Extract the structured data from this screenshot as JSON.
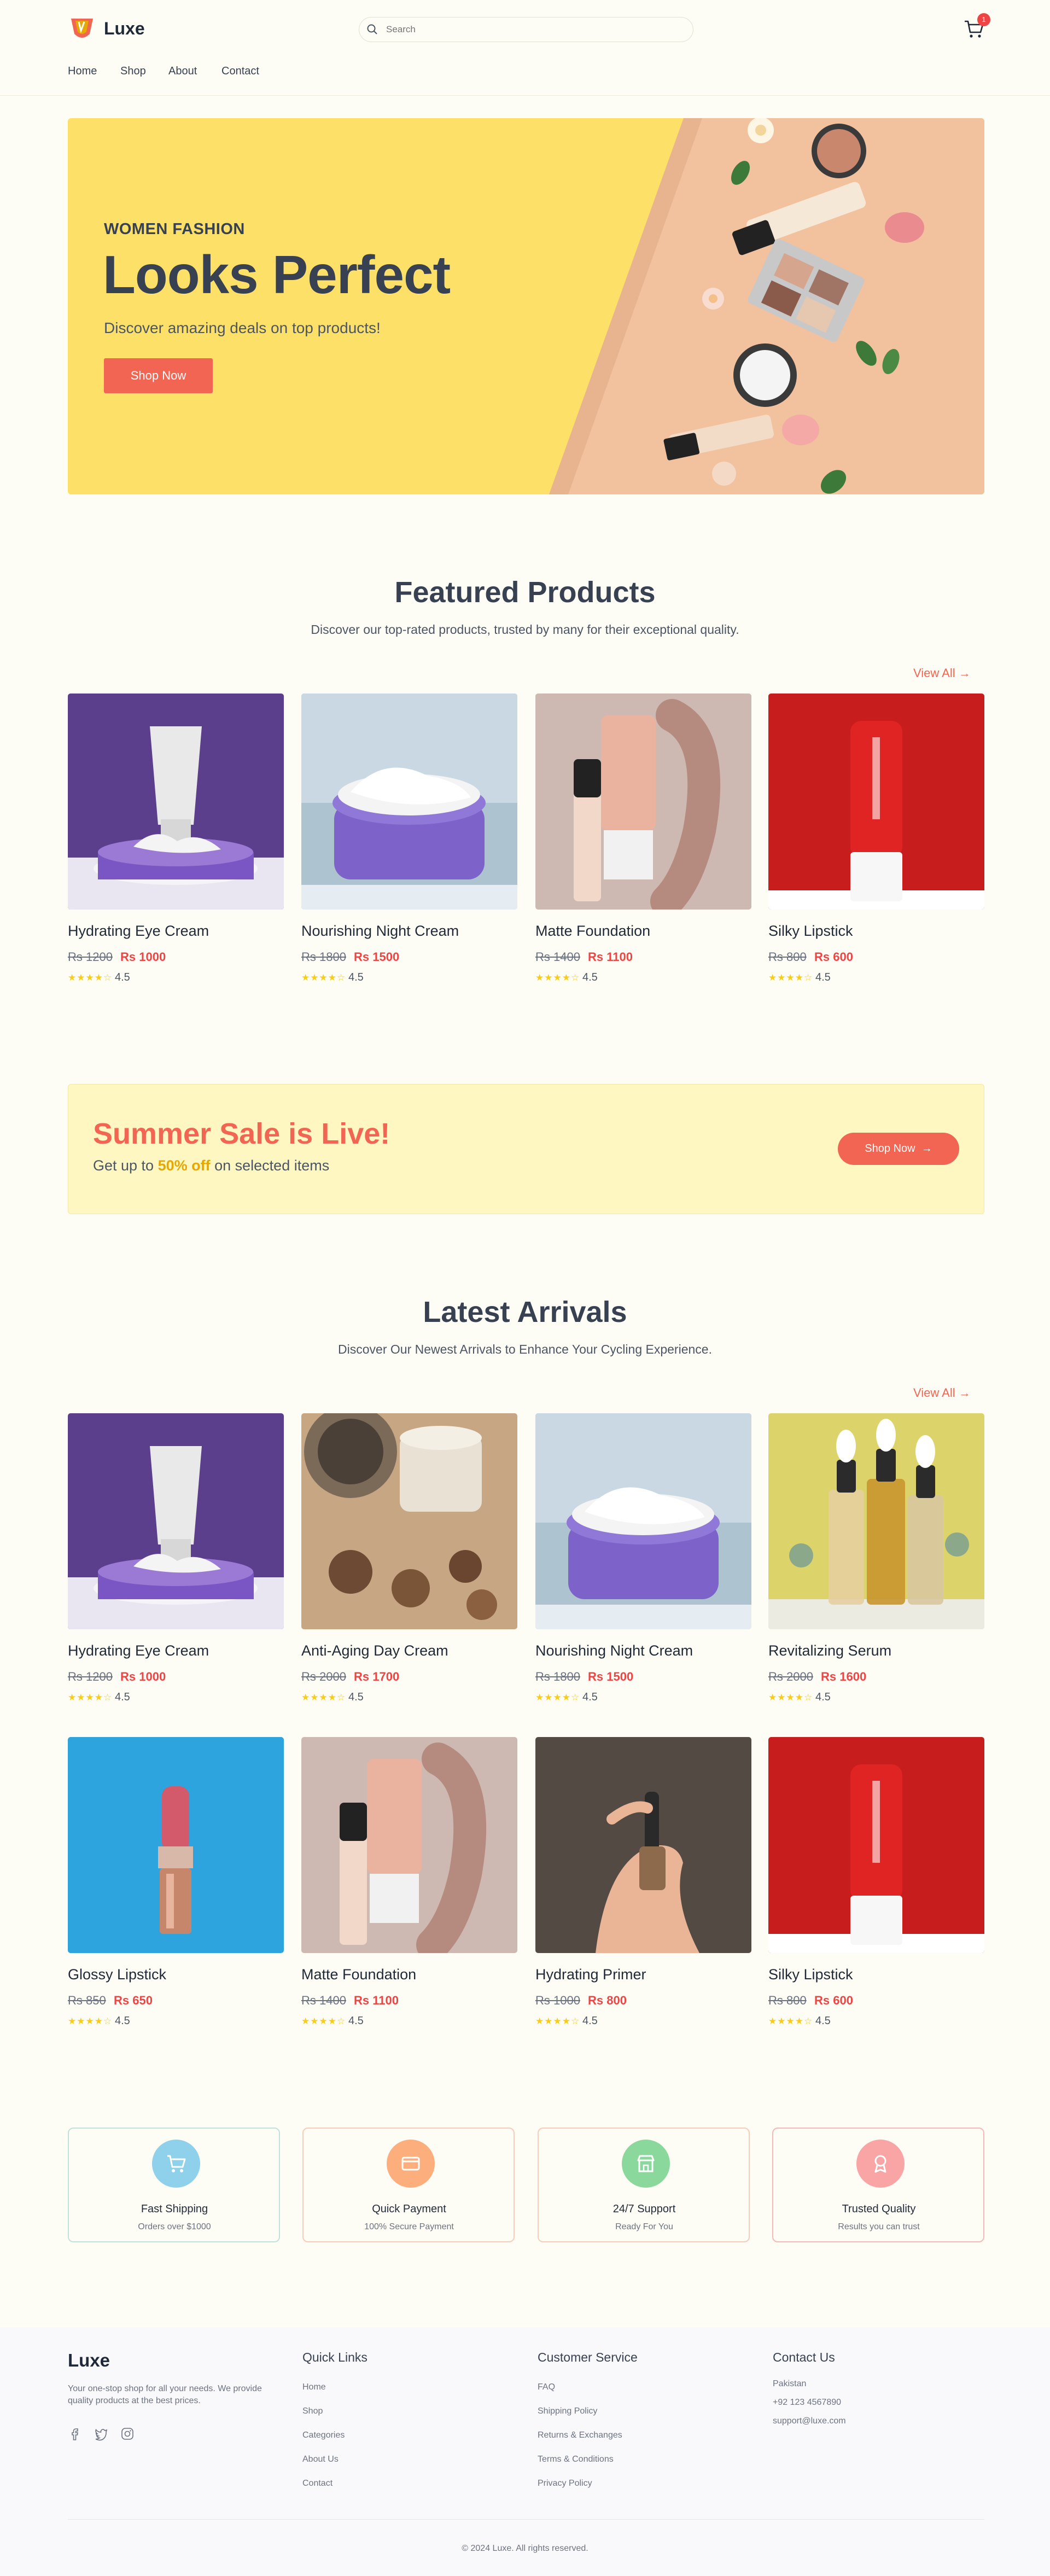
{
  "header": {
    "brand": "Luxe",
    "search_placeholder": "Search",
    "cart_count": "1",
    "nav": [
      "Home",
      "Shop",
      "About",
      "Contact"
    ]
  },
  "hero": {
    "eyebrow": "WOMEN FASHION",
    "title": "Looks Perfect",
    "subtitle": "Discover amazing deals on top products!",
    "button": "Shop Now"
  },
  "featured": {
    "title": "Featured Products",
    "subtitle": "Discover our top-rated products, trusted by many for their exceptional quality.",
    "view_all": "View All",
    "products": [
      {
        "name": "Hydrating Eye Cream",
        "old_price": "Rs 1200",
        "price": "Rs 1000",
        "stars": "★★★★☆",
        "rating": "4.5",
        "image": "eye-cream-tube"
      },
      {
        "name": "Nourishing Night Cream",
        "old_price": "Rs 1800",
        "price": "Rs 1500",
        "stars": "★★★★☆",
        "rating": "4.5",
        "image": "night-cream-jar"
      },
      {
        "name": "Matte Foundation",
        "old_price": "Rs 1400",
        "price": "Rs 1100",
        "stars": "★★★★☆",
        "rating": "4.5",
        "image": "foundation-tubes"
      },
      {
        "name": "Silky Lipstick",
        "old_price": "Rs 800",
        "price": "Rs 600",
        "stars": "★★★★☆",
        "rating": "4.5",
        "image": "red-lipstick"
      }
    ]
  },
  "sale": {
    "title": "Summer Sale is Live!",
    "subtitle_prefix": "Get up to ",
    "highlight": "50% off",
    "subtitle_suffix": " on selected items",
    "button": "Shop Now"
  },
  "latest": {
    "title": "Latest Arrivals",
    "subtitle": "Discover Our Newest Arrivals to Enhance Your Cycling Experience.",
    "view_all": "View All",
    "products": [
      {
        "name": "Hydrating Eye Cream",
        "old_price": "Rs 1200",
        "price": "Rs 1000",
        "stars": "★★★★☆",
        "rating": "4.5",
        "image": "eye-cream-tube"
      },
      {
        "name": "Anti-Aging Day Cream",
        "old_price": "Rs 2000",
        "price": "Rs 1700",
        "stars": "★★★★☆",
        "rating": "4.5",
        "image": "day-cream-jar"
      },
      {
        "name": "Nourishing Night Cream",
        "old_price": "Rs 1800",
        "price": "Rs 1500",
        "stars": "★★★★☆",
        "rating": "4.5",
        "image": "night-cream-jar"
      },
      {
        "name": "Revitalizing Serum",
        "old_price": "Rs 2000",
        "price": "Rs 1600",
        "stars": "★★★★☆",
        "rating": "4.5",
        "image": "serum-bottles"
      },
      {
        "name": "Glossy Lipstick",
        "old_price": "Rs 850",
        "price": "Rs 650",
        "stars": "★★★★☆",
        "rating": "4.5",
        "image": "pink-lipstick"
      },
      {
        "name": "Matte Foundation",
        "old_price": "Rs 1400",
        "price": "Rs 1100",
        "stars": "★★★★☆",
        "rating": "4.5",
        "image": "foundation-tubes"
      },
      {
        "name": "Hydrating Primer",
        "old_price": "Rs 1000",
        "price": "Rs 800",
        "stars": "★★★★☆",
        "rating": "4.5",
        "image": "primer-dropper"
      },
      {
        "name": "Silky Lipstick",
        "old_price": "Rs 800",
        "price": "Rs 600",
        "stars": "★★★★☆",
        "rating": "4.5",
        "image": "red-lipstick"
      }
    ]
  },
  "features": [
    {
      "title": "Fast Shipping",
      "subtitle": "Orders over $1000",
      "icon": "cart-icon",
      "color": "#8fd0ea",
      "border": "#bfe3dc"
    },
    {
      "title": "Quick Payment",
      "subtitle": "100% Secure Payment",
      "icon": "credit-card-icon",
      "color": "#fdae7d",
      "border": "#f6cdb8"
    },
    {
      "title": "24/7 Support",
      "subtitle": "Ready For You",
      "icon": "store-icon",
      "color": "#8bd89c",
      "border": "#f6cdb8"
    },
    {
      "title": "Trusted Quality",
      "subtitle": "Results you can trust",
      "icon": "award-icon",
      "color": "#f9a5a5",
      "border": "#f6b8b8"
    }
  ],
  "footer": {
    "brand": "Luxe",
    "description": "Your one-stop shop for all your needs. We provide quality products at the best prices.",
    "social": [
      "facebook-icon",
      "twitter-icon",
      "instagram-icon"
    ],
    "quick_links": {
      "title": "Quick Links",
      "items": [
        "Home",
        "Shop",
        "Categories",
        "About Us",
        "Contact"
      ]
    },
    "customer_service": {
      "title": "Customer Service",
      "items": [
        "FAQ",
        "Shipping Policy",
        "Returns & Exchanges",
        "Terms & Conditions",
        "Privacy Policy"
      ]
    },
    "contact": {
      "title": "Contact Us",
      "items": [
        "Pakistan",
        "+92 123 4567890",
        "support@luxe.com"
      ]
    },
    "copyright": "© 2024 Luxe. All rights reserved."
  },
  "colors": {
    "accent": "#f16552",
    "hero_bg": "#fde068",
    "star": "#facc15",
    "price": "#ef4444"
  }
}
